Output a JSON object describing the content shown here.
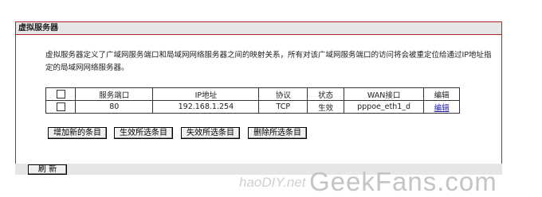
{
  "panel": {
    "title": "虚拟服务器",
    "description": "虚拟服务器定义了广域网服务端口和局域网网络服务器之间的映射关系，所有对该广域网服务端口的访问将会被重定位给通过IP地址指定的局域网网络服务器。"
  },
  "table": {
    "headers": [
      "",
      "服务端口",
      "IP地址",
      "协议",
      "状态",
      "WAN接口",
      "编辑"
    ],
    "rows": [
      {
        "port": "80",
        "ip": "192.168.1.254",
        "protocol": "TCP",
        "status": "生效",
        "wan": "pppoe_eth1_d",
        "edit": "编辑"
      }
    ]
  },
  "buttons": {
    "add": "增加新的条目",
    "enable": "生效所选条目",
    "disable": "失效所选条目",
    "delete": "删除所选条目",
    "refresh": "刷 新"
  },
  "watermark": {
    "small": "haoDIY.net",
    "big": "GeekFans.com"
  }
}
